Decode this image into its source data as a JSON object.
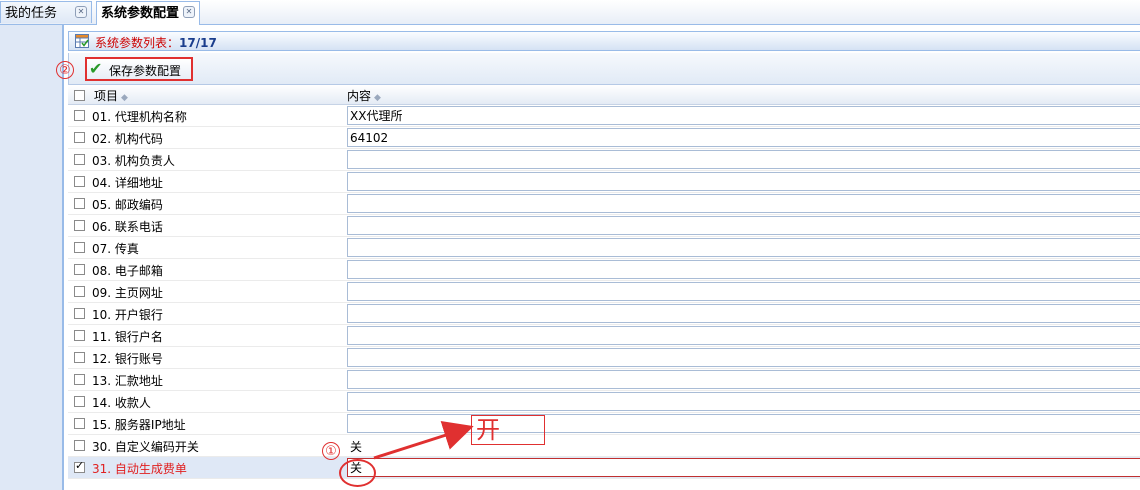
{
  "tabs": [
    {
      "label": "我的任务",
      "active": false
    },
    {
      "label": "系统参数配置",
      "active": true
    }
  ],
  "panel": {
    "title": "系统参数列表：",
    "count": "17/17"
  },
  "toolbar": {
    "save_label": "保存参数配置"
  },
  "grid": {
    "columns": [
      "项目",
      "内容"
    ],
    "rows": [
      {
        "label": "01. 代理机构名称",
        "value": "XX代理所",
        "kind": "input"
      },
      {
        "label": "02. 机构代码",
        "value": "64102",
        "kind": "input"
      },
      {
        "label": "03. 机构负责人",
        "value": "",
        "kind": "input"
      },
      {
        "label": "04. 详细地址",
        "value": "",
        "kind": "input"
      },
      {
        "label": "05. 邮政编码",
        "value": "",
        "kind": "input"
      },
      {
        "label": "06. 联系电话",
        "value": "",
        "kind": "input"
      },
      {
        "label": "07. 传真",
        "value": "",
        "kind": "input"
      },
      {
        "label": "08. 电子邮箱",
        "value": "",
        "kind": "input"
      },
      {
        "label": "09. 主页网址",
        "value": "",
        "kind": "input"
      },
      {
        "label": "10. 开户银行",
        "value": "",
        "kind": "input"
      },
      {
        "label": "11. 银行户名",
        "value": "",
        "kind": "input"
      },
      {
        "label": "12. 银行账号",
        "value": "",
        "kind": "input"
      },
      {
        "label": "13. 汇款地址",
        "value": "",
        "kind": "input"
      },
      {
        "label": "14. 收款人",
        "value": "",
        "kind": "input"
      },
      {
        "label": "15. 服务器IP地址",
        "value": "",
        "kind": "input"
      },
      {
        "label": "30. 自定义编码开关",
        "value": "关",
        "kind": "text"
      },
      {
        "label": "31. 自动生成费单",
        "value": "关",
        "kind": "input",
        "checked": true,
        "highlight": true
      }
    ]
  },
  "annotations": {
    "marker_1": "①",
    "marker_2": "②",
    "popup_value": "开"
  },
  "colors": {
    "accent_red": "#e03030",
    "border_blue": "#99bbe8",
    "selected_row": "#dfe8f6"
  }
}
